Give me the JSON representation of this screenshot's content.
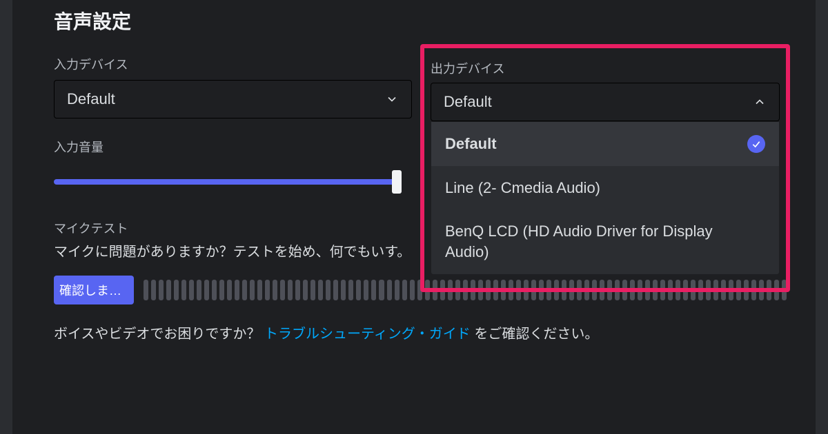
{
  "section_title": "音声設定",
  "input_device": {
    "label": "入力デバイス",
    "value": "Default"
  },
  "output_device": {
    "label": "出力デバイス",
    "value": "Default",
    "options": [
      {
        "label": "Default",
        "selected": true
      },
      {
        "label": "Line (2- Cmedia Audio)",
        "selected": false
      },
      {
        "label": "BenQ LCD (HD Audio Driver for Display Audio)",
        "selected": false
      }
    ]
  },
  "input_volume": {
    "label": "入力音量",
    "percent": 100
  },
  "mic_test": {
    "label": "マイクテスト",
    "description_pre": "マイクに問題がありますか？テストを始め、何でもいす。",
    "button_label": "確認しまし..."
  },
  "footer": {
    "prefix": "ボイスやビデオでお困りですか？ ",
    "link_text": "トラブルシューティング・ガイド",
    "suffix": " をご確認ください。"
  }
}
